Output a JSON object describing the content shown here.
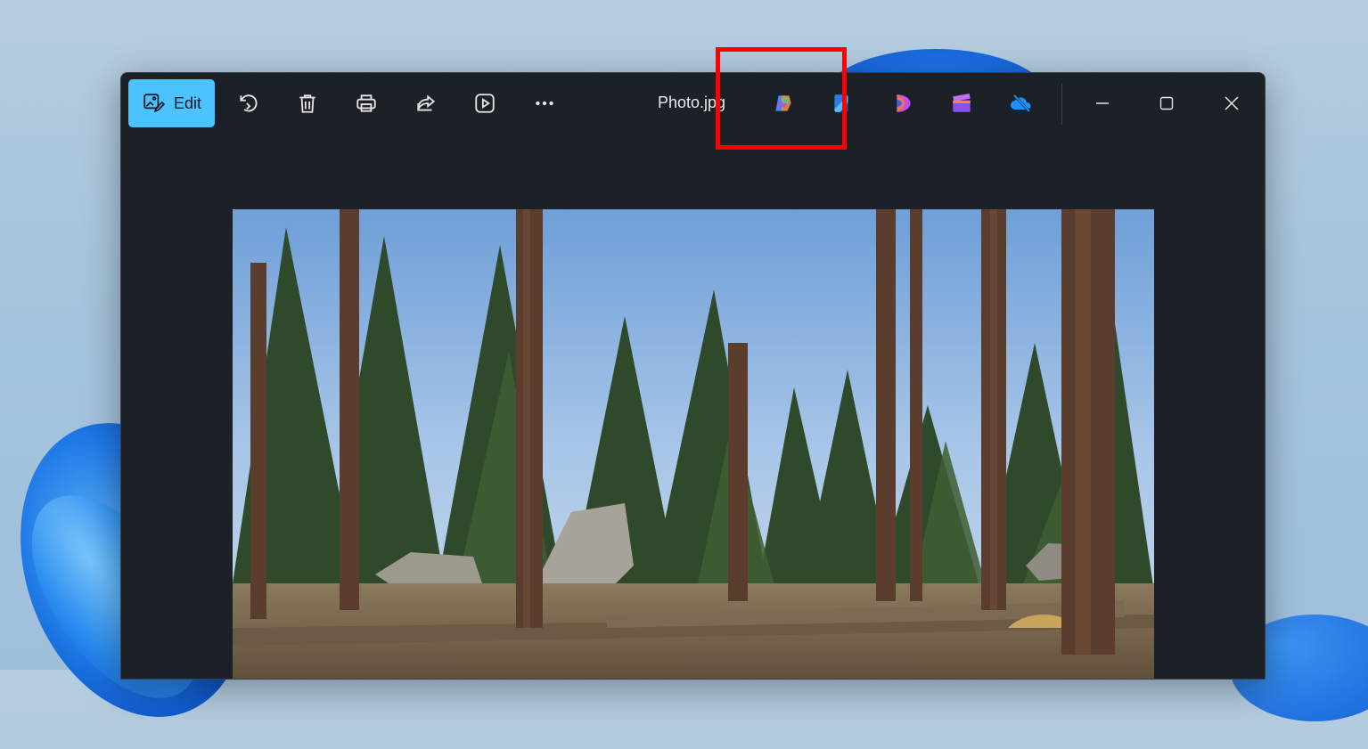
{
  "window": {
    "title": "Photo.jpg"
  },
  "toolbar": {
    "edit_label": "Edit",
    "actions": [
      {
        "icon": "rotate-icon"
      },
      {
        "icon": "delete-icon"
      },
      {
        "icon": "print-icon"
      },
      {
        "icon": "share-icon"
      },
      {
        "icon": "slideshow-icon"
      },
      {
        "icon": "more-icon"
      }
    ],
    "apps": [
      {
        "icon": "copilot-icon"
      },
      {
        "icon": "designer-icon"
      },
      {
        "icon": "clipchamp-icon"
      },
      {
        "icon": "video-editor-icon"
      },
      {
        "icon": "onedrive-icon"
      }
    ]
  },
  "window_controls": [
    "minimize-icon",
    "maximize-icon",
    "close-icon"
  ],
  "colors": {
    "accent": "#4cc2ff",
    "highlight": "#ff0000",
    "window_bg": "#1c2128"
  }
}
